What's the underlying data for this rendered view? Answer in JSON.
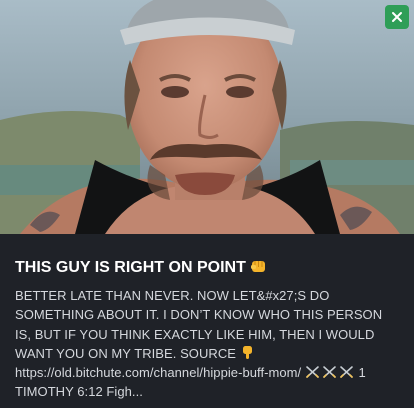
{
  "card": {
    "title": "THIS GUY IS RIGHT ON POINT",
    "title_emoji": "fist-icon",
    "description_part1": "BETTER LATE THAN NEVER. NOW LET&#x27;S DO SOMETHING ABOUT IT. I DON’T KNOW WHO THIS PERSON IS, BUT IF YOU THINK EXACTLY LIKE HIM, THEN I WOULD WANT YOU ON MY TRIBE. SOURCE",
    "description_emoji": "pointing-down-icon",
    "description_part2": "https://old.bitchute.com/channel/hippie-buff-mom/",
    "description_swords": "crossed-swords-icon",
    "description_part3": "1 TIMOTHY 6:12  Figh..."
  },
  "close_button": {
    "icon": "close-icon"
  },
  "colors": {
    "background": "#1f2228",
    "close_button": "#2e9e57",
    "title_text": "#ffffff",
    "description_text": "#d5d8dd"
  }
}
